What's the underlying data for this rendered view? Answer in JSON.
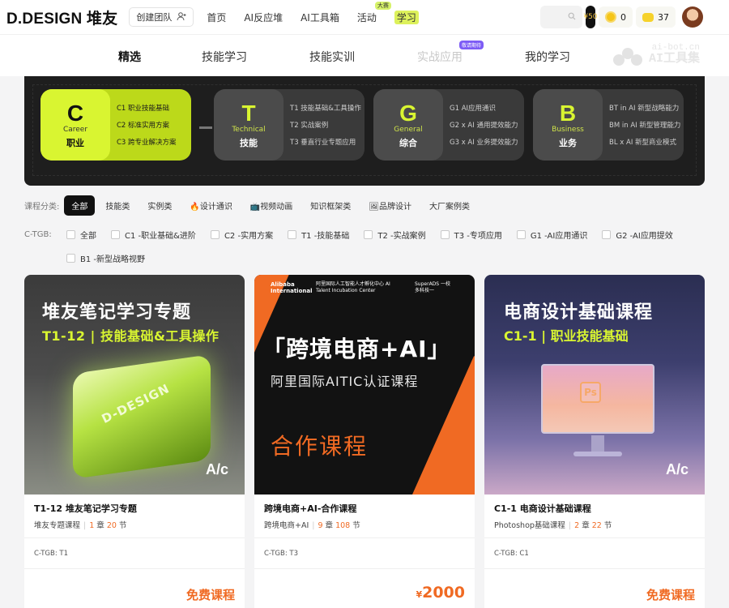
{
  "header": {
    "logo": "D.DESIGN 堆友",
    "team_button": "创建团队",
    "nav": [
      "首页",
      "AI反应堆",
      "AI工具箱",
      "活动",
      "学习"
    ],
    "nav_badge": "大赛",
    "coin_a_pill": "¥50",
    "coin_b": "0",
    "coin_c": "37"
  },
  "tabs": {
    "items": [
      "精选",
      "技能学习",
      "技能实训",
      "实战应用",
      "我的学习"
    ],
    "badge": "敬请期待",
    "watermark_line1": "ai-bot.cn",
    "watermark_line2": "AI工具集"
  },
  "banner": {
    "groups": [
      {
        "letter": "C",
        "en": "Career",
        "zh": "职业",
        "lines": [
          "C1 职业技能基础",
          "C2 标准实用方案",
          "C3 跨专业解决方案"
        ]
      },
      {
        "letter": "T",
        "en": "Technical",
        "zh": "技能",
        "lines": [
          "T1 技能基础&工具操作",
          "T2 实战案例",
          "T3 垂直行业专题应用"
        ]
      },
      {
        "letter": "G",
        "en": "General",
        "zh": "综合",
        "lines": [
          "G1  AI应用通识",
          "G2 x AI 通用提效能力",
          "G3 x AI 业务提效能力"
        ]
      },
      {
        "letter": "B",
        "en": "Business",
        "zh": "业务",
        "lines": [
          "BT in AI 新型战略能力",
          "BM in AI 新型管理能力",
          "BL x AI 新型商业模式"
        ]
      }
    ]
  },
  "filters": {
    "category_label": "课程分类:",
    "categories": [
      "全部",
      "技能类",
      "实例类",
      "设计通识",
      "视频动画",
      "知识框架类",
      "品牌设计",
      "大厂案例类"
    ],
    "ctgb_label": "C-TGB:",
    "ctgb_row1": [
      "全部",
      "C1 -职业基础&进阶",
      "C2 -实用方案",
      "T1 -技能基础",
      "T2 -实战案例",
      "T3 -专项应用",
      "G1 -AI应用通识",
      "G2 -AI应用提效"
    ],
    "ctgb_row2": [
      "B1 -新型战略视野"
    ]
  },
  "cards": [
    {
      "image_title": "堆友笔记学习专题",
      "image_subtitle": "T1-12 | 技能基础&工具操作",
      "image_text": "D-DESIGN",
      "image_mark": "A/c",
      "title": "T1-12 堆友笔记学习专题",
      "meta_type": "堆友专题课程",
      "chapters": "1",
      "chapters_unit": "章",
      "sections": "20",
      "sections_unit": "节",
      "tag": "C-TGB:  T1",
      "price": "免费课程"
    },
    {
      "image_logos": [
        "Alibaba International",
        "阿里国际人工智能人才孵化中心 AI Talent Incubation Center",
        "SuperADS 一校多科技一"
      ],
      "image_title": "「跨境电商+AI」",
      "image_subtitle": "阿里国际AITIC认证课程",
      "image_tagline": "合作课程",
      "title": "跨境电商+AI-合作课程",
      "meta_type": "跨境电商+AI",
      "chapters": "9",
      "chapters_unit": "章",
      "sections": "108",
      "sections_unit": "节",
      "tag": "C-TGB:  T3",
      "price_symbol": "¥",
      "price": "2000"
    },
    {
      "image_title": "电商设计基础课程",
      "image_subtitle": "C1-1 | 职业技能基础",
      "image_text": "Ps",
      "image_mark": "A/c",
      "title": "C1-1 电商设计基础课程",
      "meta_type": "Photoshop基础课程",
      "chapters": "2",
      "chapters_unit": "章",
      "sections": "22",
      "sections_unit": "节",
      "tag": "C-TGB:  C1",
      "price": "免费课程"
    }
  ],
  "colors": {
    "accent": "#d9f531",
    "orange": "#f06a23",
    "dark": "#1e1e1e"
  }
}
